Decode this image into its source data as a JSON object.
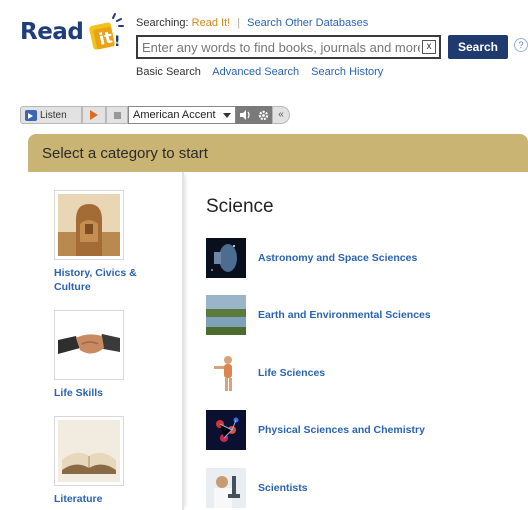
{
  "header": {
    "logo_text": "Read",
    "searching_label": "Searching:",
    "current_db": "Read It!",
    "other_db_link": "Search Other Databases",
    "search_placeholder": "Enter any words to find books, journals and more",
    "clear_icon": "x",
    "search_button": "Search",
    "help_icon": "?",
    "links": {
      "basic": "Basic Search",
      "advanced": "Advanced Search",
      "history": "Search History"
    }
  },
  "toolbar": {
    "listen_label": "Listen",
    "accent_selected": "American Accent",
    "collapse_icon": "«"
  },
  "panel": {
    "title": "Select a category to start",
    "categories": [
      {
        "label": "History, Civics & Culture"
      },
      {
        "label": "Life Skills"
      },
      {
        "label": "Literature"
      }
    ],
    "section_title": "Science",
    "subcategories": [
      {
        "label": "Astronomy and Space Sciences"
      },
      {
        "label": "Earth and Environmental Sciences"
      },
      {
        "label": "Life Sciences"
      },
      {
        "label": "Physical Sciences and Chemistry"
      },
      {
        "label": "Scientists"
      }
    ]
  },
  "colors": {
    "brand_navy": "#1f3a6e",
    "panel_header": "#c9b473",
    "link_blue": "#2a63b3",
    "current_db_orange": "#d08a1c"
  }
}
